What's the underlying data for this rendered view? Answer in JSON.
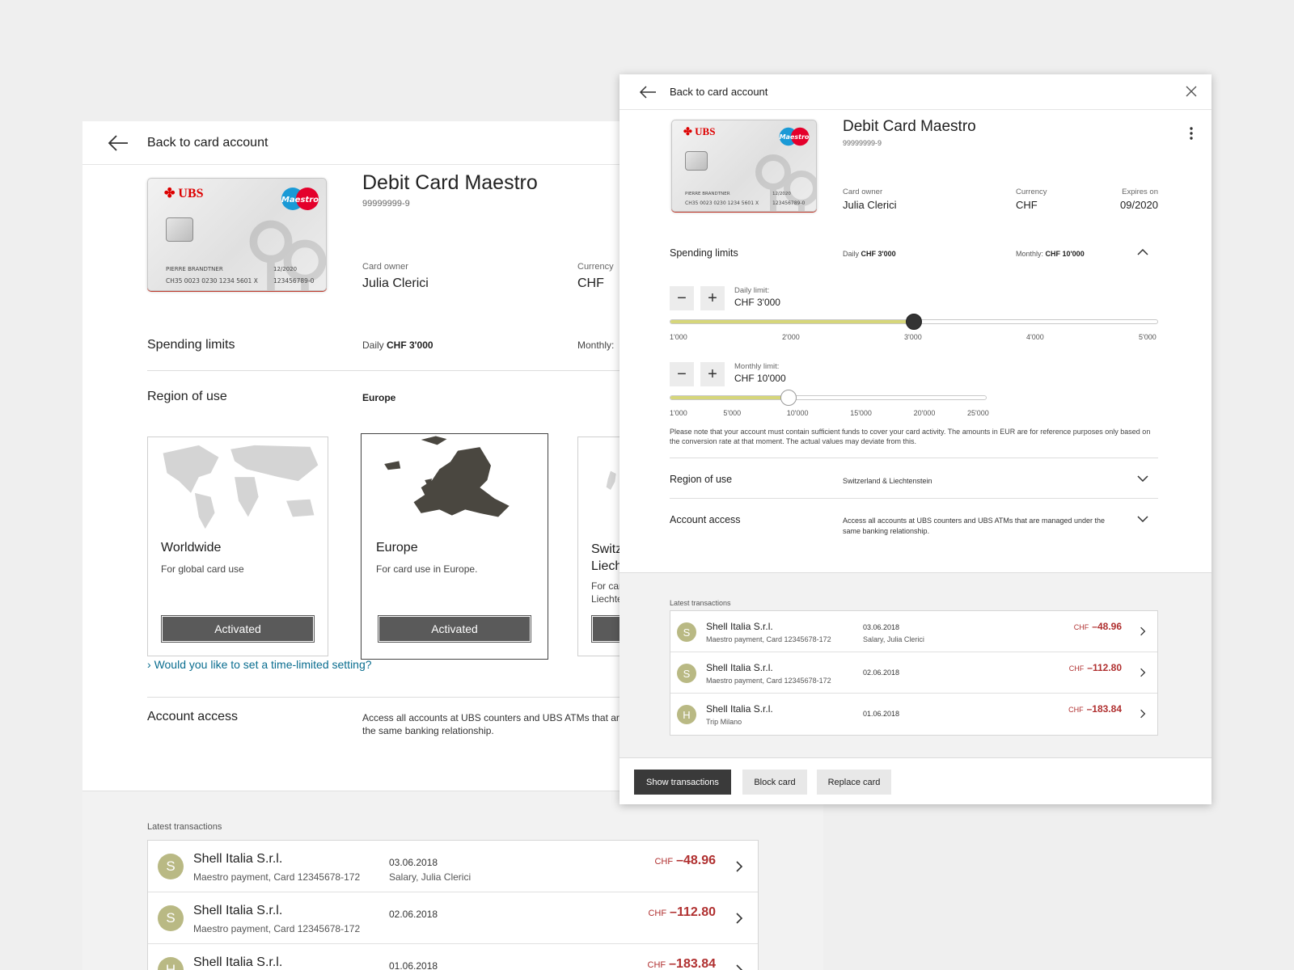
{
  "colors": {
    "accent_link": "#0a6d8f",
    "negative": "#b03030",
    "slider_fill": "#d6d67a",
    "avatar": "#b9b984"
  },
  "bg": {
    "back_label": "Back to card account",
    "card_title": "Debit Card Maestro",
    "account_number": "99999999-9",
    "card_owner_label": "Card owner",
    "card_owner": "Julia Clerici",
    "currency_label": "Currency",
    "currency": "CHF",
    "card": {
      "brand": "UBS",
      "scheme": "Maestro",
      "holder": "PIERRE BRANDTNER",
      "iban": "CH35 0023 0230 1234 5601 X",
      "expiry": "12/2020",
      "account": "123456789-0"
    },
    "spending_limits": "Spending limits",
    "daily_label": "Daily",
    "daily_value": "CHF 3'000",
    "monthly_label": "Monthly:",
    "region_title": "Region of use",
    "region_value": "Europe",
    "regions": [
      {
        "title": "Worldwide",
        "desc": "For global card use",
        "button": "Activated"
      },
      {
        "title": "Europe",
        "desc": "For card use in Europe.",
        "button": "Activated"
      },
      {
        "title": "Switz Liech",
        "desc": "For car Liechte"
      }
    ],
    "time_limited_link": "Would you like to set a time-limited setting?",
    "account_access_title": "Account access",
    "account_access_text": "Access all accounts at UBS counters and UBS ATMs that ar the same banking relationship.",
    "latest_transactions": "Latest transactions",
    "transactions": [
      {
        "avatar": "S",
        "merchant": "Shell Italia S.r.l.",
        "desc": "Maestro payment, Card 12345678-172",
        "date": "03.06.2018",
        "detail": "Salary, Julia Clerici",
        "currency": "CHF",
        "amount": "–48.96"
      },
      {
        "avatar": "S",
        "merchant": "Shell Italia S.r.l.",
        "desc": "Maestro payment, Card 12345678-172",
        "date": "02.06.2018",
        "detail": "",
        "currency": "CHF",
        "amount": "–112.80"
      },
      {
        "avatar": "H",
        "merchant": "Shell Italia S.r.l.",
        "desc": "",
        "date": "01.06.2018",
        "detail": "",
        "currency": "CHF",
        "amount": "–183.84"
      }
    ]
  },
  "fg": {
    "back_label": "Back to card account",
    "card_title": "Debit Card Maestro",
    "account_number": "99999999-9",
    "card_owner_label": "Card owner",
    "card_owner": "Julia Clerici",
    "currency_label": "Currency",
    "currency": "CHF",
    "expires_label": "Expires on",
    "expires": "09/2020",
    "spending_limits": "Spending limits",
    "daily_label": "Daily",
    "daily_value": "CHF 3'000",
    "monthly_label": "Monthly:",
    "monthly_value": "CHF 10'000",
    "daily_limit_label": "Daily limit:",
    "daily_limit_value": "CHF 3'000",
    "daily_ticks": [
      "1'000",
      "2'000",
      "3'000",
      "4'000",
      "5'000"
    ],
    "daily_slider_level": 0.5,
    "monthly_limit_label": "Monthly limit:",
    "monthly_limit_value": "CHF 10'000",
    "monthly_ticks": [
      "1'000",
      "5'000",
      "10'000",
      "15'000",
      "20'000",
      "25'000"
    ],
    "monthly_slider_level": 0.375,
    "note": "Please note that your account must contain sufficient funds to cover your card activity. The amounts in EUR are for reference purposes only based on the conversion rate at that moment. The actual values may deviate from this.",
    "region_title": "Region of use",
    "region_value": "Switzerland & Liechtenstein",
    "account_access_title": "Account access",
    "account_access_text": "Access all accounts at UBS counters and UBS ATMs that are managed under the same banking relationship.",
    "latest_transactions": "Latest transactions",
    "transactions": [
      {
        "avatar": "S",
        "merchant": "Shell Italia S.r.l.",
        "desc": "Maestro payment, Card 12345678-172",
        "date": "03.06.2018",
        "detail": "Salary, Julia Clerici",
        "currency": "CHF",
        "amount": "–48.96"
      },
      {
        "avatar": "S",
        "merchant": "Shell Italia S.r.l.",
        "desc": "Maestro payment, Card 12345678-172",
        "date": "02.06.2018",
        "detail": "",
        "currency": "CHF",
        "amount": "–112.80"
      },
      {
        "avatar": "H",
        "merchant": "Shell Italia S.r.l.",
        "desc": "Trip Milano",
        "date": "01.06.2018",
        "detail": "",
        "currency": "CHF",
        "amount": "–183.84"
      }
    ],
    "buttons": {
      "show_transactions": "Show transactions",
      "block_card": "Block card",
      "replace_card": "Replace card"
    }
  }
}
